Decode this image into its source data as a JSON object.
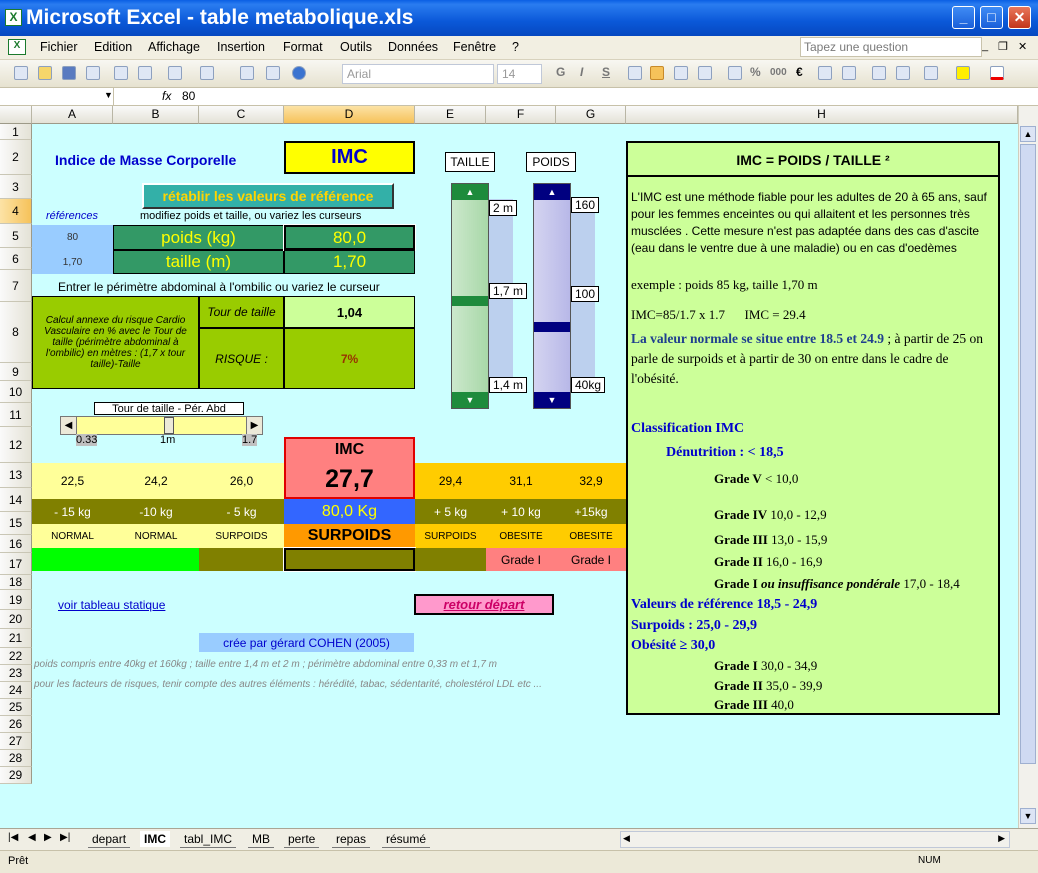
{
  "window": {
    "title": "Microsoft Excel - table metabolique.xls",
    "min": "_",
    "max": "□",
    "close": "✕"
  },
  "menu": [
    "Fichier",
    "Edition",
    "Affichage",
    "Insertion",
    "Format",
    "Outils",
    "Données",
    "Fenêtre",
    "?"
  ],
  "ask": "Tapez une question",
  "toolbar": {
    "font": "Arial",
    "size": "14",
    "bold": "G",
    "italic": "I",
    "underline": "S",
    "percent": "%",
    "thousands": "000",
    "euro": "€"
  },
  "formula": {
    "fx": "fx",
    "value": "80"
  },
  "columns": [
    "A",
    "B",
    "C",
    "D",
    "E",
    "F",
    "G",
    "H"
  ],
  "rows": [
    "1",
    "2",
    "3",
    "4",
    "5",
    "6",
    "7",
    "8",
    "9",
    "10",
    "11",
    "12",
    "13",
    "14",
    "15",
    "16",
    "17",
    "18",
    "19",
    "20",
    "21",
    "22",
    "23",
    "24",
    "25",
    "26",
    "27",
    "28",
    "29"
  ],
  "sheet": {
    "title": "Indice de Masse Corporelle",
    "imc_box": "IMC",
    "btn_reset": "rétablir les valeurs de référence",
    "references": "références",
    "instr1": "modifiez poids et taille, ou variez les curseurs",
    "ref_weight": "80",
    "ref_height": "1,70",
    "poids_label": "poids (kg)",
    "poids_value": "80,0",
    "taille_label": "taille (m)",
    "taille_value": "1,70",
    "instr2": "Entrer le périmètre abdominal à l'ombilic ou variez le curseur",
    "annex": "Calcul annexe du risque Cardio Vasculaire  en % avec le Tour de taille (périmètre abdominal à l'ombilic) en mètres : (1,7 x tour taille)-Taille",
    "tour_label": "Tour de taille",
    "tour_value": "1,04",
    "risque_label": "RISQUE :",
    "risque_value": "7%",
    "slider_label": "Tour de taille  - Pér. Abd",
    "slider_min": "0.33",
    "slider_mid": "1m",
    "slider_max": "1.7",
    "slider_level": 0.55,
    "taille_title": "TAILLE",
    "poids_title": "POIDS",
    "t_top": "2 m",
    "t_mid": "1,7 m",
    "t_bot": "1,4 m",
    "p_top": "160",
    "p_mid": "100",
    "p_bot": "40kg",
    "imc_label": "IMC",
    "imc_value": "27,7",
    "r12": [
      "22,5",
      "24,2",
      "26,0",
      "29,4",
      "31,1",
      "32,9"
    ],
    "r13": [
      "- 15 kg",
      "-10 kg",
      "- 5 kg",
      "80,0 Kg",
      "+ 5 kg",
      "+ 10 kg",
      "+15kg"
    ],
    "r14": [
      "NORMAL",
      "NORMAL",
      "SURPOIDS",
      "SURPOIDS",
      "SURPOIDS",
      "OBESITE",
      "OBESITE"
    ],
    "r15": [
      "Grade I",
      "Grade I"
    ],
    "link_static": "voir tableau statique",
    "btn_back": "retour départ",
    "credit": "crée par gérard COHEN (2005)",
    "note20": "poids compris entre 40kg et 160kg ; taille entre 1,4 m et 2 m ; périmètre abdominal entre 0,33 m et 1,7 m",
    "note21": "pour les facteurs de risques, tenir compte des autres éléments : hérédité, tabac, sédentarité, cholestérol LDL etc ..."
  },
  "panel": {
    "title": "IMC = POIDS / TAILLE ²",
    "p1": "L'IMC est une méthode fiable pour les adultes de 20 à 65 ans, sauf pour les femmes enceintes ou qui allaitent et les personnes très musclées . Cette mesure n'est pas adaptée dans des cas d'ascite (eau dans le ventre due à une maladie) ou en cas d'oedèmes",
    "p2": "exemple : poids 85 kg, taille 1,70 m",
    "p3": "IMC=85/1.7 x 1.7      IMC = 29.4",
    "p4a": "La valeur normale se situe entre 18.5 et 24.9",
    "p4b": " ; à partir de 25 on parle de surpoids et à partir de 30 on entre dans le cadre de l'obésité.",
    "c_title": "Classification IMC",
    "den": "Dénutrition : < 18,5",
    "g5": "Grade V",
    "g5v": " < 10,0",
    "g4": "Grade IV",
    "g4v": " 10,0 - 12,9",
    "g3": "Grade III",
    "g3v": " 13,0 - 15,9",
    "g2": "Grade II",
    "g2v": " 16,0 - 16,9",
    "g1": "Grade I",
    "g1i": " ou insuffisance pondérale",
    "g1v": " 17,0 - 18,4",
    "ref": "Valeurs de référence 18,5 - 24,9",
    "sur": "Surpoids : 25,0 - 29,9",
    "obe": "Obésité ≥ 30,0",
    "o1": "Grade I",
    "o1v": " 30,0 - 34,9",
    "o2": "Grade II",
    "o2v": " 35,0 - 39,9",
    "o3": "Grade III",
    "o3v": " 40,0"
  },
  "tabs": [
    "depart",
    "IMC",
    "tabl_IMC",
    "MB",
    "perte",
    "repas",
    "résumé"
  ],
  "status": {
    "left": "Prêt",
    "num": "NUM"
  }
}
